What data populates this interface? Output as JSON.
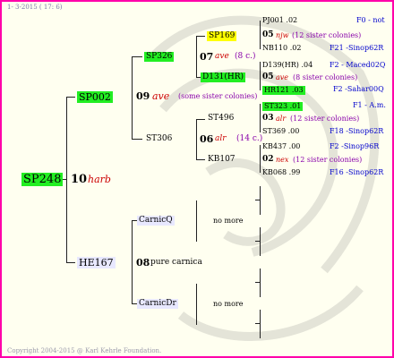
{
  "header": {
    "date": "1-  3-2015 ( 17:  6)"
  },
  "footer": "Copyright 2004-2015 @ Karl Kehrle Foundation.",
  "colors": {
    "border": "#ff00aa",
    "highlight_green": "#22ee22",
    "highlight_yellow": "#ffff00",
    "lavender": "#e8e8ff"
  },
  "root": {
    "id": "SP248",
    "num": "10",
    "breeder": "harb"
  },
  "gen1": {
    "sire": {
      "id": "SP002",
      "num": "09",
      "breeder": "ave",
      "note": "(some sister colonies)"
    },
    "dam": {
      "id": "HE167",
      "num": "08",
      "breeder": "pure carnica"
    }
  },
  "gen2": {
    "a": {
      "id": "SP326",
      "num": "07",
      "breeder": "ave",
      "note": "(8 c.)"
    },
    "b": {
      "id": "ST306",
      "num": "06",
      "breeder": "alr",
      "note": "(14 c.)"
    },
    "c": {
      "id": "CarnicQ",
      "nomore": "no more"
    },
    "d": {
      "id": "CarnicDr",
      "nomore": "no more"
    }
  },
  "gen3": {
    "a1": {
      "id": "SP169"
    },
    "a2": {
      "id": "D131(HR)"
    },
    "b1": {
      "id": "ST496"
    },
    "b2": {
      "id": "KB107"
    }
  },
  "gen4": [
    {
      "id": "PJ001 .02",
      "loc": "F0 - not"
    },
    {
      "num": "05",
      "breeder": "njw",
      "note": "(12 sister colonies)"
    },
    {
      "id": "NB110 .02",
      "loc": "F21 -Sinop62R"
    },
    {
      "id": "D139(HR) .04",
      "loc": "F2 - Maced02Q"
    },
    {
      "num": "05",
      "breeder": "ave",
      "note": "(8 sister colonies)"
    },
    {
      "id": "HR121 .03",
      "loc": "F2 -Sahar00Q"
    },
    {
      "id": "ST323 .01",
      "loc": "F1 - A.m."
    },
    {
      "num": "03",
      "breeder": "alr",
      "note": "(12 sister colonies)"
    },
    {
      "id": "ST369 .00",
      "loc": "F18 -Sinop62R"
    },
    {
      "id": "KB437 .00",
      "loc": "F2 -Sinop96R"
    },
    {
      "num": "02",
      "breeder": "nex",
      "note": "(12 sister colonies)"
    },
    {
      "id": "KB068 .99",
      "loc": "F16 -Sinop62R"
    }
  ]
}
